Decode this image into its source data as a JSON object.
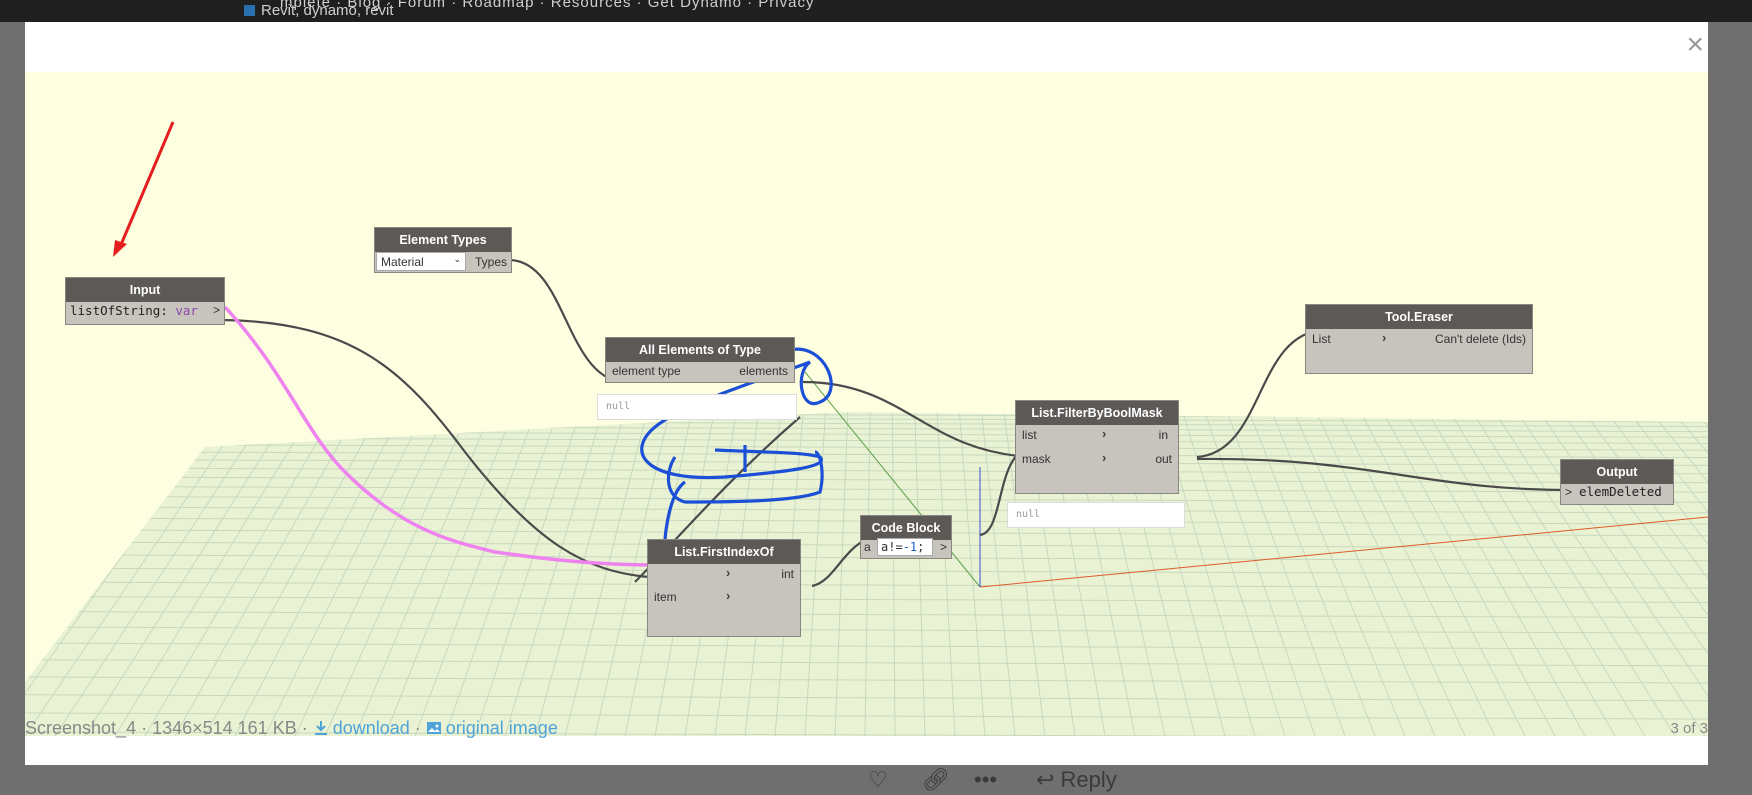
{
  "background_page": {
    "nav_text": "mplete  ·  Blog  ·  Forum  ·  Roadmap  ·  Resources  ·  Get Dynamo  ·  Privacy",
    "tags": "Revit, dynamo, revit",
    "reply_label": "Reply"
  },
  "lightbox": {
    "close_label": "×",
    "caption": {
      "filename": "Screenshot_4",
      "meta": " · 1346×514 161 KB · ",
      "download_label": "download",
      "separator": " · ",
      "original_label": "original image"
    },
    "counter": "3 of 3"
  },
  "graph": {
    "nodes": {
      "input": {
        "title": "Input",
        "code_name": "listOfString",
        "code_sep": ": ",
        "code_type": "var",
        "out_port": ">"
      },
      "element_types": {
        "title": "Element Types",
        "dropdown_value": "Material",
        "out_port": "Types"
      },
      "all_elements": {
        "title": "All Elements of Type",
        "in_port": "element type",
        "out_port": "elements",
        "preview": "null"
      },
      "first_index": {
        "title": "List.FirstIndexOf",
        "in_port_2": "item",
        "out_port": "int"
      },
      "code_block": {
        "title": "Code Block",
        "in_port": "a",
        "code_a": "a",
        "code_op": "!=",
        "code_num": "-1",
        "code_end": ";",
        "out_port": ">"
      },
      "filter_mask": {
        "title": "List.FilterByBoolMask",
        "in_list": "list",
        "in_mask": "mask",
        "out_in": "in",
        "out_out": "out",
        "preview": "null"
      },
      "tool_eraser": {
        "title": "Tool.Eraser",
        "in_port": "List",
        "out_port": "Can't delete (Ids)"
      },
      "output": {
        "title": "Output",
        "in_port": ">",
        "name": "elemDeleted"
      }
    },
    "colors": {
      "canvas": "#fefee1",
      "node_header": "#5c5957",
      "annotation_blue": "#1a4fd6",
      "annotation_pink": "#ee82ee",
      "arrow_red": "#e61e1e"
    }
  }
}
